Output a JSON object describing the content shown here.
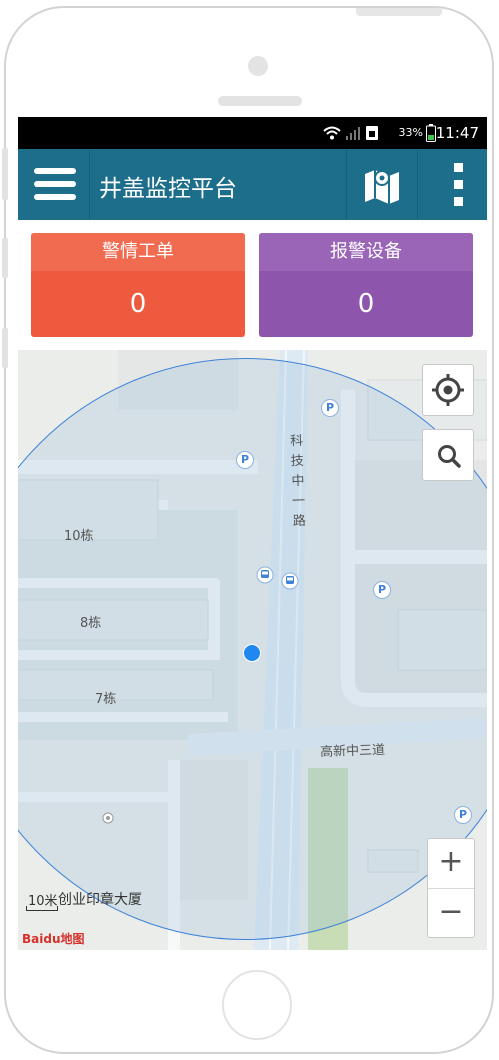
{
  "status_bar": {
    "battery_percent": "33%",
    "time": "11:47"
  },
  "app_bar": {
    "title": "井盖监控平台"
  },
  "cards": {
    "alarm_orders": {
      "label": "警情工单",
      "count": "0",
      "color": "#ee5a3e"
    },
    "alarm_devices": {
      "label": "报警设备",
      "count": "0",
      "color": "#8e55ad"
    }
  },
  "map": {
    "road_vertical": "科技中一路",
    "road_horizontal": "高新中三道",
    "building_10": "10栋",
    "building_8": "8栋",
    "building_7": "7栋",
    "scale_label": "10米",
    "poi_label": "创业印章大厦",
    "logo_text": "Baidu地图",
    "zoom_in": "+",
    "zoom_out": "−",
    "parking_symbol": "P"
  }
}
